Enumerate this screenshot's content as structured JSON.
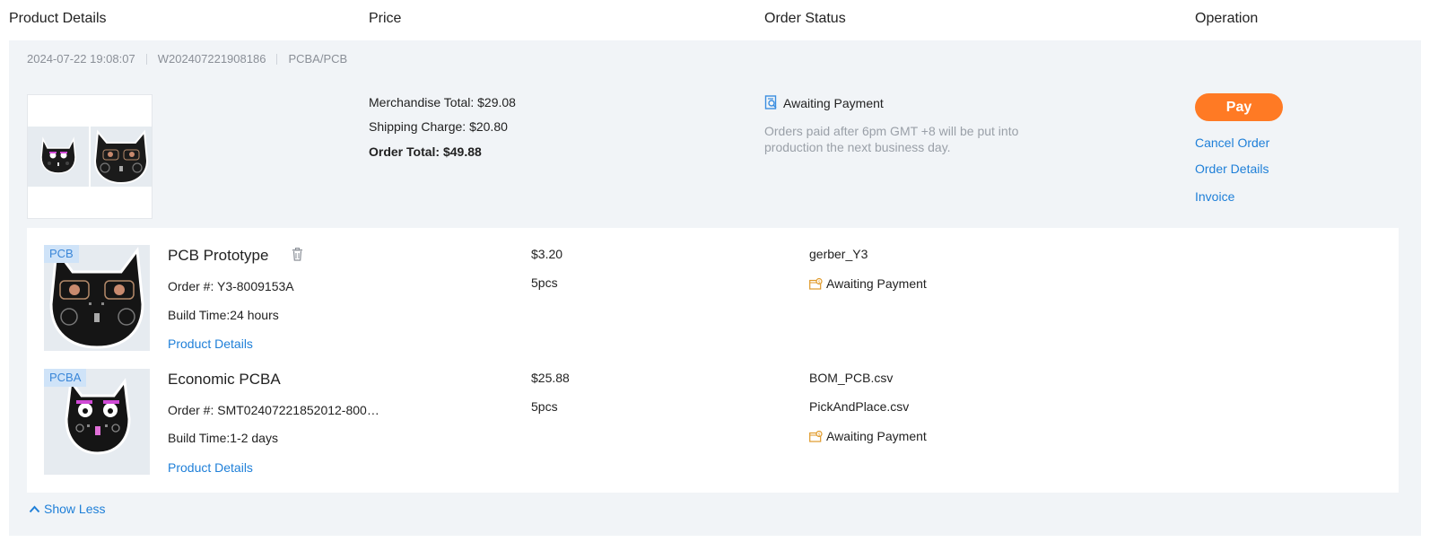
{
  "columns": {
    "product": "Product Details",
    "price": "Price",
    "status": "Order Status",
    "operation": "Operation"
  },
  "order": {
    "datetime": "2024-07-22 19:08:07",
    "number": "W202407221908186",
    "type": "PCBA/PCB",
    "merchandise": "Merchandise Total: $29.08",
    "shipping": "Shipping Charge: $20.80",
    "total": "Order Total: $49.88",
    "status": "Awaiting Payment",
    "status_note": "Orders paid after 6pm GMT +8 will be put into production the next business day.",
    "actions": {
      "pay": "Pay",
      "cancel": "Cancel Order",
      "details": "Order Details",
      "invoice": "Invoice"
    }
  },
  "items": [
    {
      "tag": "PCB",
      "name": "PCB Prototype",
      "order_no": "Order #: Y3-8009153A",
      "build_time": "Build Time:24 hours",
      "details_link": "Product Details",
      "price": "$3.20",
      "qty": "5pcs",
      "files": [
        "gerber_Y3"
      ],
      "status": "Awaiting Payment"
    },
    {
      "tag": "PCBA",
      "name": "Economic PCBA",
      "order_no": "Order #: SMT02407221852012-800…",
      "build_time": "Build Time:1-2 days",
      "details_link": "Product Details",
      "price": "$25.88",
      "qty": "5pcs",
      "files": [
        "BOM_PCB.csv",
        "PickAndPlace.csv"
      ],
      "status": "Awaiting Payment"
    }
  ],
  "toggle": "Show Less",
  "colors": {
    "accent": "#ff7a24",
    "link": "#1e7fd8",
    "card_bg": "#f1f4f7",
    "muted": "#8a8f97"
  },
  "icons": [
    "search-doc-icon",
    "trash-icon",
    "wallet-icon",
    "chevron-up-icon"
  ]
}
